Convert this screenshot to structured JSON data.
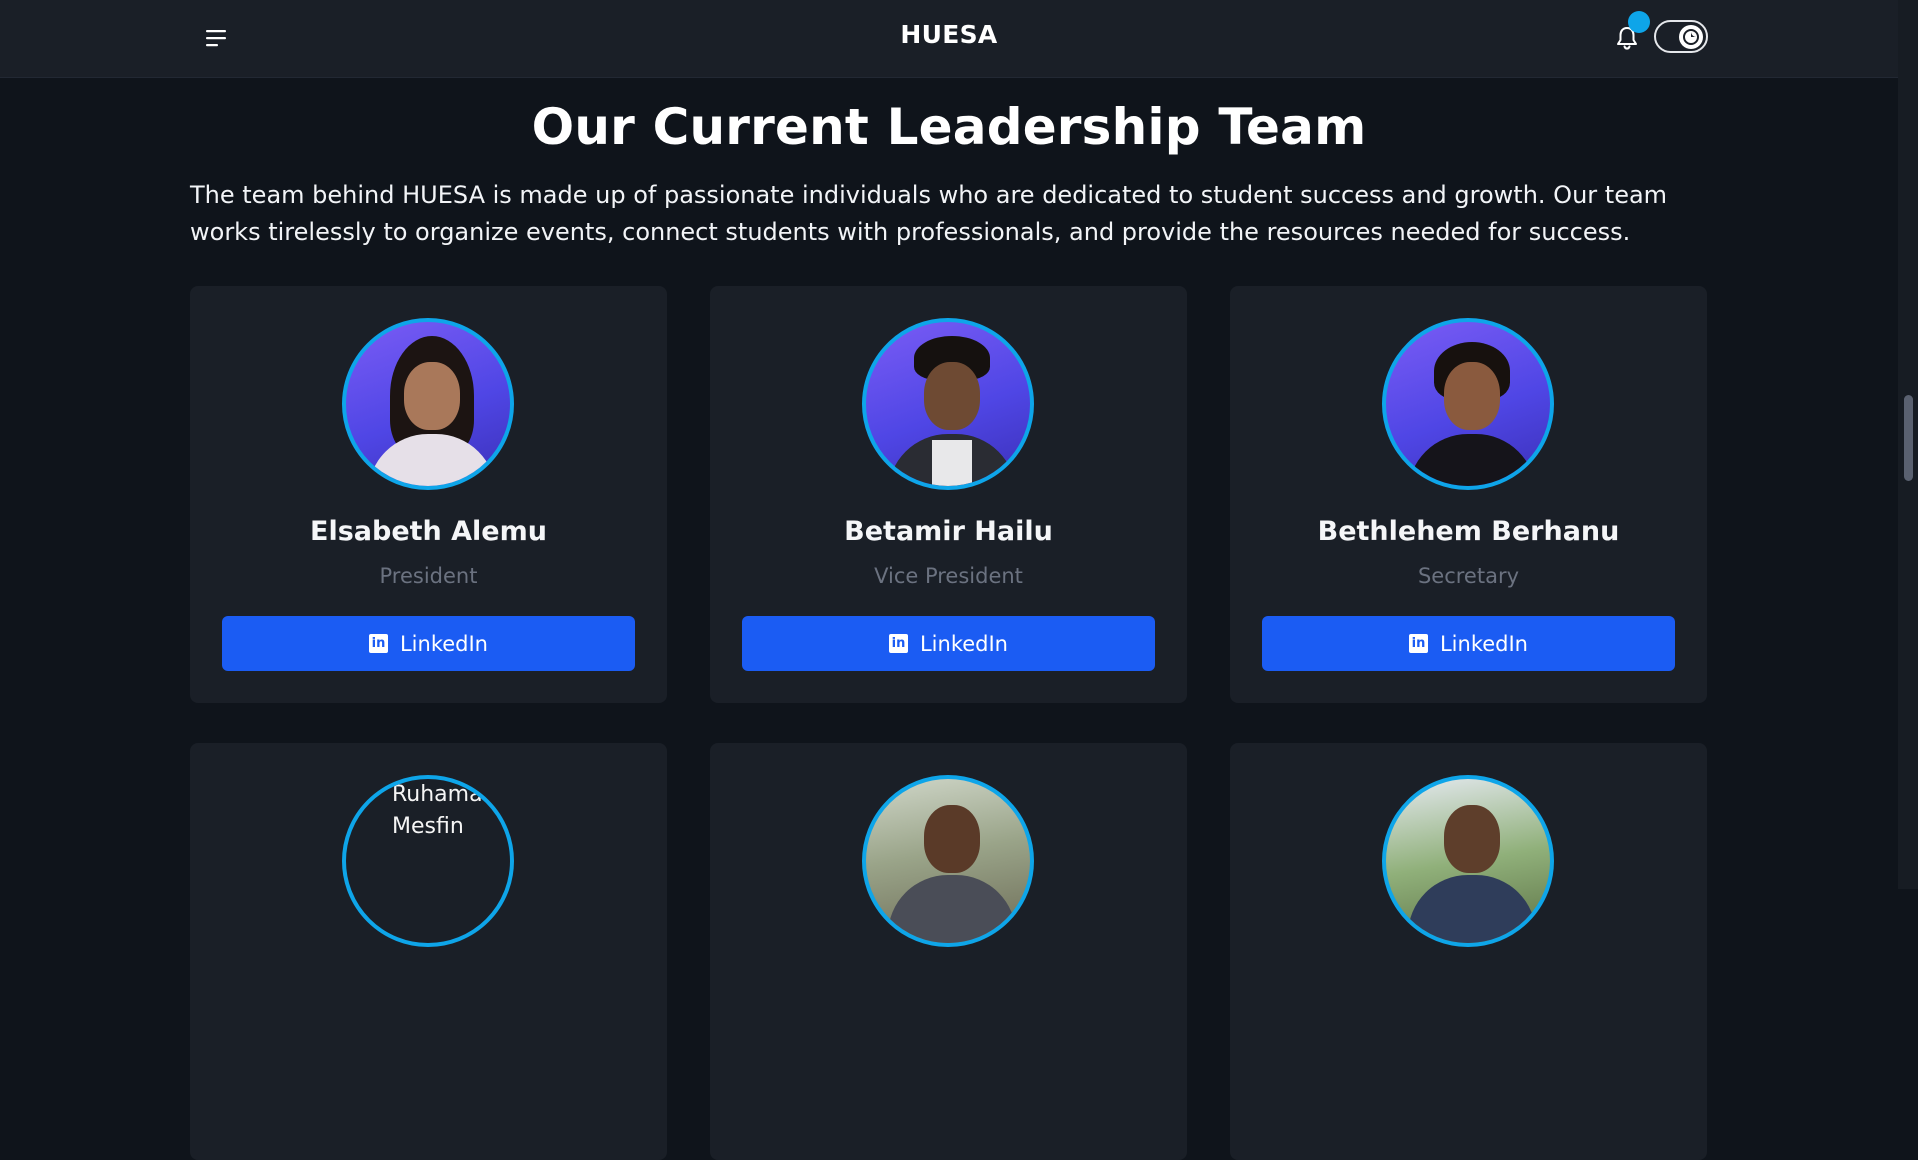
{
  "header": {
    "brand": "HUESA",
    "icons": {
      "menu": "menu-icon",
      "bell": "bell-icon",
      "theme": "moon-icon"
    },
    "accent": "#0ea5e9"
  },
  "main": {
    "title": "Our Current Leadership Team",
    "intro": "The team behind HUESA is made up of passionate individuals who are dedicated to student success and growth. Our team works tirelessly to organize events, connect students with professionals, and provide the resources needed for success."
  },
  "team": [
    {
      "name": "Elsabeth Alemu",
      "role": "President",
      "link_label": "LinkedIn"
    },
    {
      "name": "Betamir Hailu",
      "role": "Vice President",
      "link_label": "LinkedIn"
    },
    {
      "name": "Bethlehem Berhanu",
      "role": "Secretary",
      "link_label": "LinkedIn"
    },
    {
      "photo_alt": "Ruhama Mesfin"
    }
  ],
  "colors": {
    "card": "#1a1f27",
    "button": "#1b5cf3",
    "background": "#0f141b"
  }
}
